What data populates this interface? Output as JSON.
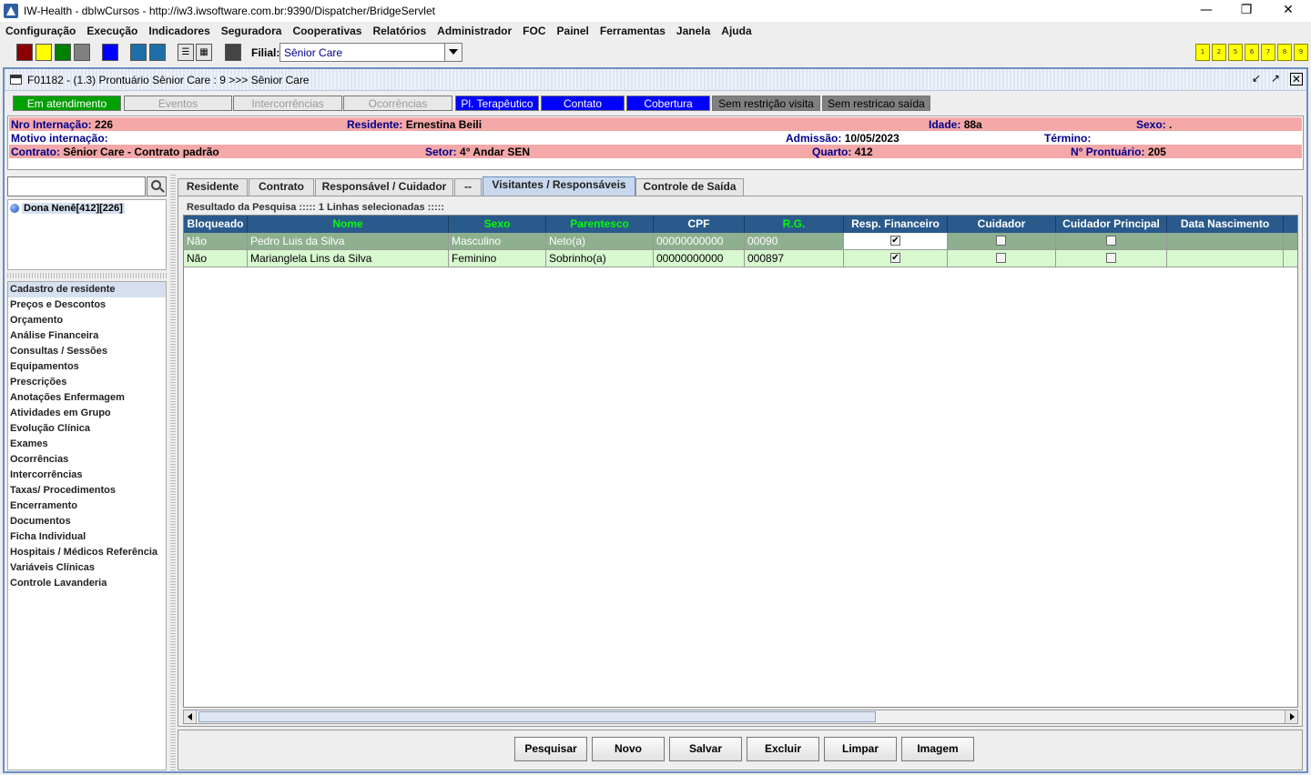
{
  "window": {
    "title": "IW-Health - dbIwCursos - http://iw3.iwsoftware.com.br:9390/Dispatcher/BridgeServlet"
  },
  "menu": [
    "Configuração",
    "Execução",
    "Indicadores",
    "Seguradora",
    "Cooperativas",
    "Relatórios",
    "Administrador",
    "FOC",
    "Painel",
    "Ferramentas",
    "Janela",
    "Ajuda"
  ],
  "toolbar": {
    "swatch_colors": [
      "#8b0000",
      "#ffff00",
      "#008000",
      "#808080",
      "#0000ff",
      "#1e6fa8",
      "#1e6fa8",
      "#444444"
    ],
    "filial_label": "Filial:",
    "filial_value": "Sênior Care",
    "num_buttons": [
      "1",
      "2",
      "5",
      "6",
      "7",
      "8",
      "9"
    ]
  },
  "inner_window": {
    "title": "F01182 - (1.3) Prontuário Sênior Care : 9 >>> Sênior Care"
  },
  "status_buttons": [
    {
      "label": "Em atendimento",
      "bg": "#00a000",
      "fg": "#ffffff"
    },
    {
      "label": "Eventos",
      "bg": "#e8e8e8",
      "fg": "#999999"
    },
    {
      "label": "Intercorrências",
      "bg": "#e8e8e8",
      "fg": "#999999"
    },
    {
      "label": "Ocorrências",
      "bg": "#e8e8e8",
      "fg": "#999999"
    },
    {
      "label": "Pl. Terapêutico",
      "bg": "#0000ff",
      "fg": "#ffffff"
    },
    {
      "label": "Contato",
      "bg": "#0000ff",
      "fg": "#ffffff"
    },
    {
      "label": "Cobertura",
      "bg": "#0000ff",
      "fg": "#ffffff"
    },
    {
      "label": "Sem restrição visita",
      "bg": "#808080",
      "fg": "#000000"
    },
    {
      "label": "Sem restricao saída",
      "bg": "#808080",
      "fg": "#000000"
    }
  ],
  "info": {
    "row1": {
      "internacao_label": "Nro Internação:",
      "internacao_value": "226",
      "residente_label": "Residente:",
      "residente_value": "Ernestina Beili",
      "idade_label": "Idade:",
      "idade_value": "88a",
      "sexo_label": "Sexo:",
      "sexo_value": "."
    },
    "row2": {
      "motivo_label": "Motivo internação:",
      "admissao_label": "Admissão:",
      "admissao_value": "10/05/2023",
      "termino_label": "Término:"
    },
    "row3": {
      "contrato_label": "Contrato:",
      "contrato_value": "Sênior Care - Contrato padrão",
      "setor_label": "Setor:",
      "setor_value": "4° Andar SEN",
      "quarto_label": "Quarto:",
      "quarto_value": "412",
      "prontuario_label": "N° Prontuário:",
      "prontuario_value": "205"
    }
  },
  "left": {
    "search_value": "",
    "resident_item": "Dona Nenê[412][226]",
    "nav_items": [
      "Cadastro de residente",
      "Preços e Descontos",
      "Orçamento",
      "Análise Financeira",
      "Consultas / Sessões",
      "Equipamentos",
      "Prescrições",
      "Anotações Enfermagem",
      "Atividades em Grupo",
      "Evolução Clínica",
      "Exames",
      "Ocorrências",
      "Intercorrências",
      "Taxas/ Procedimentos",
      "Encerramento",
      "Documentos",
      "Ficha Individual",
      "Hospitais / Médicos Referência",
      "Variáveis Clínicas",
      "Controle Lavanderia"
    ],
    "selected_nav": "Cadastro de residente"
  },
  "tabs": [
    "Residente",
    "Contrato",
    "Responsável / Cuidador",
    "--",
    "Visitantes / Responsáveis",
    "Controle de Saída"
  ],
  "active_tab": "Visitantes / Responsáveis",
  "grid": {
    "caption": "Resultado da Pesquisa ::::: 1 Linhas selecionadas :::::",
    "columns": [
      "Bloqueado",
      "Nome",
      "Sexo",
      "Parentesco",
      "CPF",
      "R.G.",
      "Resp. Financeiro",
      "Cuidador",
      "Cuidador Principal",
      "Data Nascimento"
    ],
    "rows": [
      {
        "bloqueado": "Não",
        "nome": "Pedro Luis da Silva",
        "sexo": "Masculino",
        "parentesco": "Neto(a)",
        "cpf": "00000000000",
        "rg": "00090",
        "resp_financeiro": true,
        "cuidador": false,
        "cuidador_principal": false,
        "data_nascimento": "",
        "selected": true
      },
      {
        "bloqueado": "Não",
        "nome": "Marianglela Lins da Silva",
        "sexo": "Feminino",
        "parentesco": "Sobrinho(a)",
        "cpf": "00000000000",
        "rg": "000897",
        "resp_financeiro": true,
        "cuidador": false,
        "cuidador_principal": false,
        "data_nascimento": "",
        "selected": false
      }
    ]
  },
  "actions": [
    "Pesquisar",
    "Novo",
    "Salvar",
    "Excluir",
    "Limpar",
    "Imagem"
  ]
}
